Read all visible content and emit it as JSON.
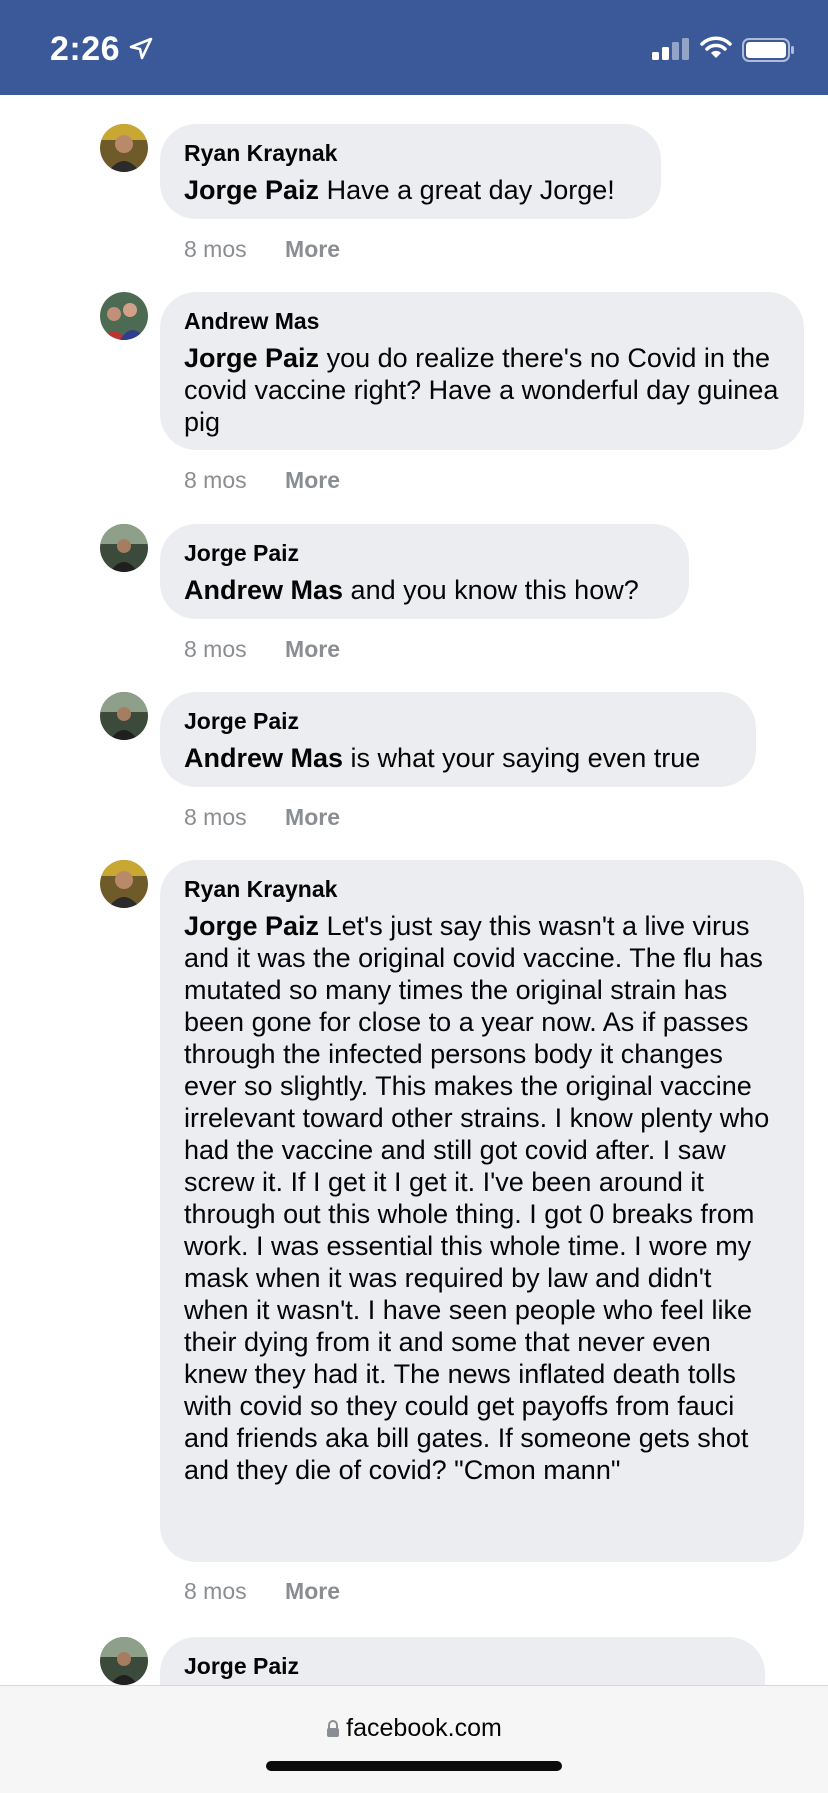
{
  "status_bar": {
    "time": "2:26",
    "icons": [
      "location-arrow-icon",
      "signal-icon",
      "wifi-icon",
      "battery-icon"
    ],
    "background": "#3b5998"
  },
  "comments": [
    {
      "author": "Ryan Kraynak",
      "mention": "Jorge Paiz",
      "text": " Have a great day Jorge!",
      "time": "8 mos",
      "action": "More"
    },
    {
      "author": "Andrew Mas",
      "mention": "Jorge Paiz",
      "text": " you do realize there's no Covid in the covid vaccine right? Have a wonderful day guinea pig",
      "time": "8 mos",
      "action": "More"
    },
    {
      "author": "Jorge Paiz",
      "mention": "Andrew Mas",
      "text": " and you know this how?",
      "time": "8 mos",
      "action": "More"
    },
    {
      "author": "Jorge Paiz",
      "mention": "Andrew Mas",
      "text": " is what your saying even true",
      "time": "8 mos",
      "action": "More"
    },
    {
      "author": "Ryan Kraynak",
      "mention": "Jorge Paiz",
      "text": " Let's just say this wasn't a live virus and it was the original covid vaccine. The flu has mutated so many times the original strain has been gone for close to a year now. As if passes through the infected persons body it changes ever so slightly. This makes the original vaccine irrelevant toward other strains. I know plenty who had the vaccine and still got covid after. I saw screw it. If I get it I get it. I've been around it through out this whole thing. I got 0 breaks from work. I was essential this whole time. I wore my mask when it was required by law and didn't when it wasn't. I have seen people who feel like their dying from it and some that never even knew they had it. The news inflated death tolls with covid so they could get payoffs from fauci and friends aka bill gates. If someone gets shot and they die of covid? \"Cmon mann\"",
      "time": "8 mos",
      "action": "More"
    },
    {
      "author": "Jorge Paiz"
    }
  ],
  "browser": {
    "url": "facebook.com"
  }
}
